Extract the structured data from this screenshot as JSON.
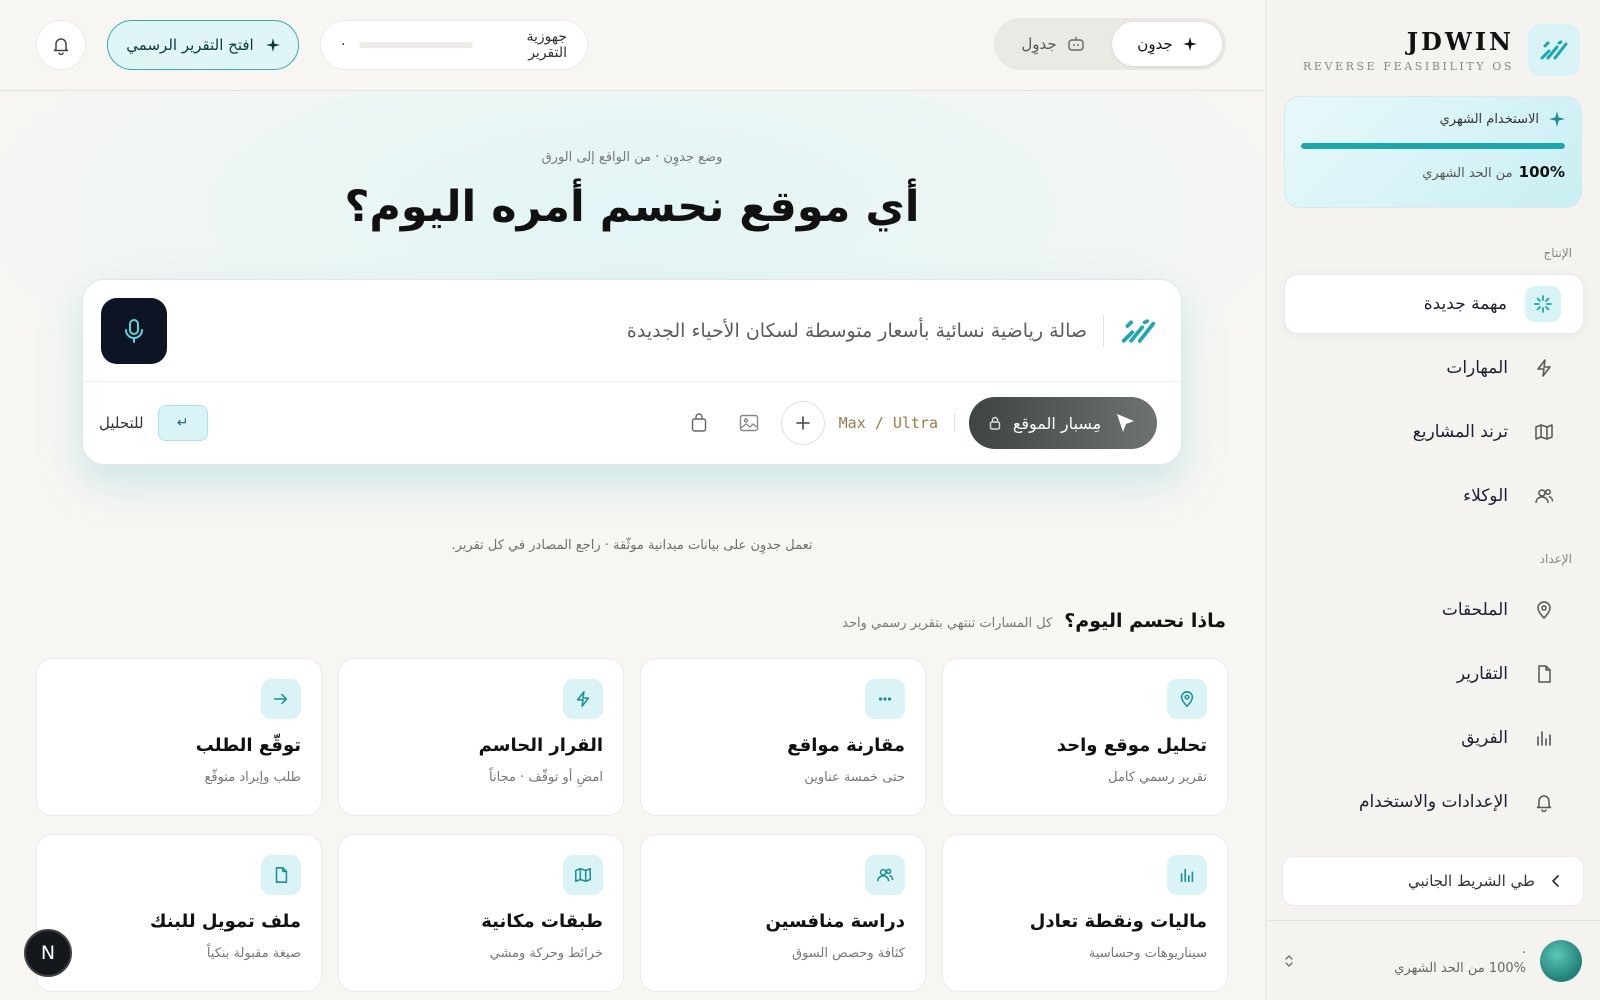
{
  "brand": {
    "name": "JDWIN",
    "subtitle": "REVERSE FEASIBILITY OS",
    "icon": "brand-slash-icon"
  },
  "usage": {
    "title": "الاستخدام الشهري",
    "percent": "100%",
    "caption": "من الحد الشهري",
    "fill": 1.0
  },
  "sidebar": {
    "section_production": "الإنتاج",
    "section_setup": "الإعداد",
    "items": [
      {
        "label": "مهمة جديدة",
        "icon": "sparkle-icon"
      },
      {
        "label": "المهارات",
        "icon": "bolt-icon"
      },
      {
        "label": "ترند المشاريع",
        "icon": "map-icon"
      },
      {
        "label": "الوكلاء",
        "icon": "users-icon"
      },
      {
        "label": "الملحقات",
        "icon": "pin-icon"
      },
      {
        "label": "التقارير",
        "icon": "file-icon"
      },
      {
        "label": "الفريق",
        "icon": "bars-icon"
      },
      {
        "label": "الإعدادات والاستخدام",
        "icon": "bell-icon"
      }
    ],
    "collapse_label": "طي الشريط الجانبي",
    "footer_dot": "·",
    "footer_text": "100% من الحد الشهري"
  },
  "topbar": {
    "mode_primary": "جدوِن",
    "mode_secondary": "جدوِل",
    "readiness_label": "جهوزية التقرير",
    "readiness_dot": "·",
    "open_report": "افتح التقرير الرسمي"
  },
  "hero": {
    "kicker": "وضع جدوِن · من الواقع إلى الورق",
    "headline": "أي موقع نحسم أمره اليوم؟"
  },
  "composer": {
    "input_value": "صالة رياضية نسائية بأسعار متوسطة لسكان الأحياء الجديدة",
    "probe_label": "مِسبار الموقع",
    "model_label": "Max / Ultra",
    "enter_key": "↵",
    "analyze_label": "للتحليل"
  },
  "trust_line": "تعمل جدوِن على بيانات ميدانية موثّقة · راجع المصادر في كل تقرير.",
  "section": {
    "title": "ماذا نحسم اليوم؟",
    "subtitle": "كل المسارات تنتهي بتقرير رسمي واحد"
  },
  "cards": [
    {
      "title": "تحليل موقع واحد",
      "subtitle": "تقرير رسمي كامل",
      "icon": "pin-icon"
    },
    {
      "title": "مقارنة مواقع",
      "subtitle": "حتى خمسة عناوين",
      "icon": "dots-icon"
    },
    {
      "title": "القرار الحاسم",
      "subtitle": "امضِ أو توقّف · مجاناً",
      "icon": "bolt-icon"
    },
    {
      "title": "توقّع الطلب",
      "subtitle": "طلب وإيراد متوقّع",
      "icon": "arrow-icon"
    },
    {
      "title": "ماليات ونقطة تعادل",
      "subtitle": "سيناريوهات وحساسية",
      "icon": "bars-icon"
    },
    {
      "title": "دراسة منافسين",
      "subtitle": "كثافة وحصص السوق",
      "icon": "users-icon"
    },
    {
      "title": "طبقات مكانية",
      "subtitle": "خرائط وحركة ومشي",
      "icon": "map-icon"
    },
    {
      "title": "ملف تمويل للبنك",
      "subtitle": "صيغة مقبولة بنكياً",
      "icon": "file-icon"
    }
  ],
  "fab": "N",
  "colors": {
    "accent": "#1ca6ad",
    "dark": "#0d1424",
    "tint": "#d9f3f6"
  }
}
